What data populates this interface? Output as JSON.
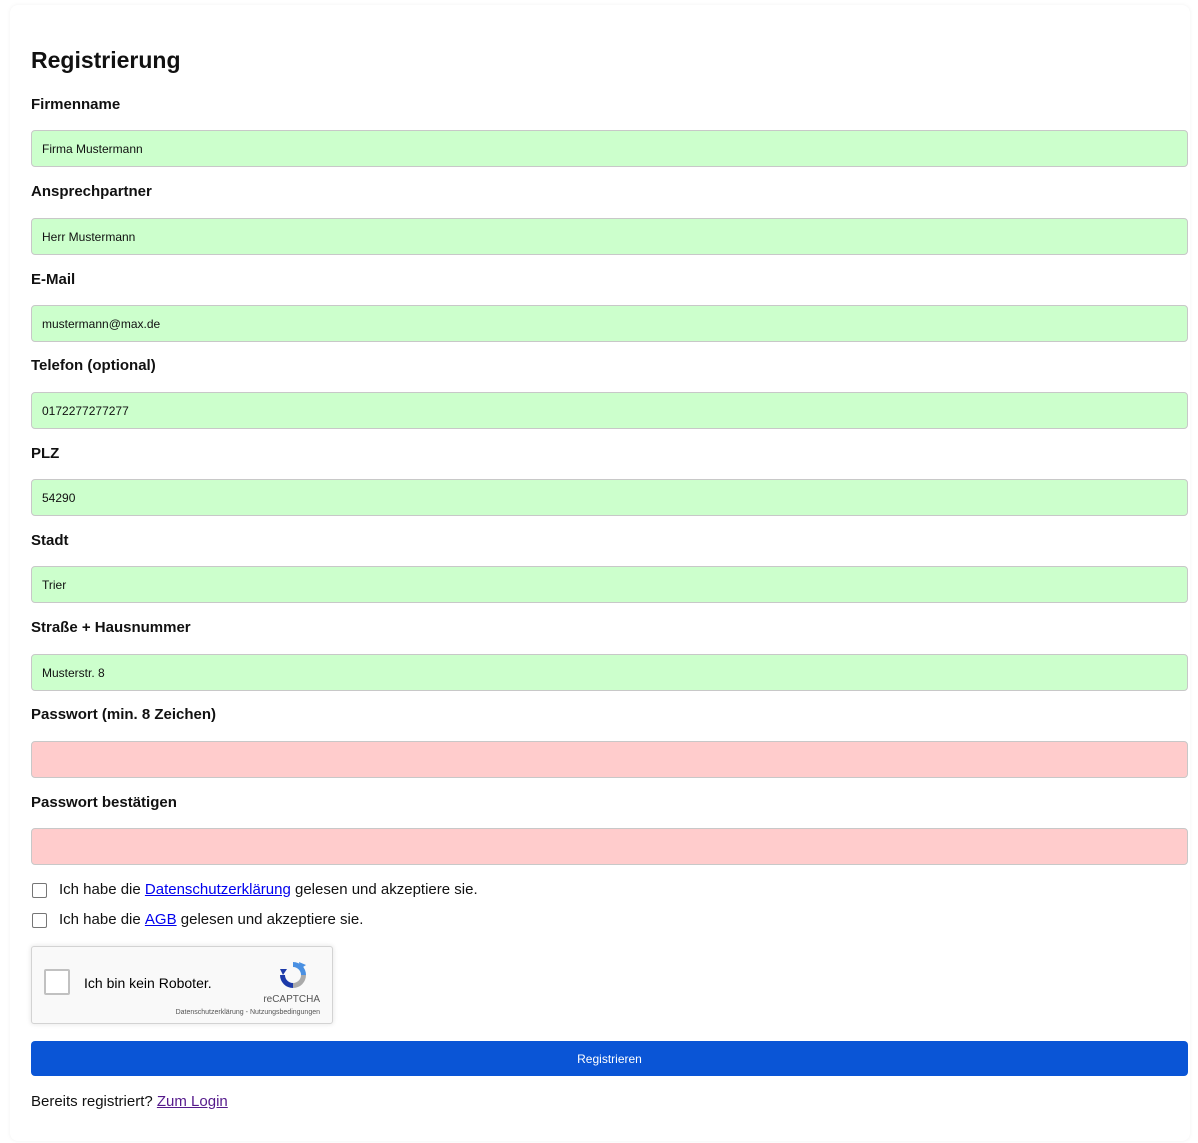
{
  "form": {
    "title": "Registrierung",
    "fields": [
      {
        "label": "Firmenname",
        "value": "Firma Mustermann",
        "state": "valid"
      },
      {
        "label": "Ansprechpartner",
        "value": "Herr Mustermann",
        "state": "valid"
      },
      {
        "label": "E-Mail",
        "value": "mustermann@max.de",
        "state": "valid"
      },
      {
        "label": "Telefon (optional)",
        "value": "0172277277277",
        "state": "valid"
      },
      {
        "label": "PLZ",
        "value": "54290",
        "state": "valid"
      },
      {
        "label": "Stadt",
        "value": "Trier",
        "state": "valid"
      },
      {
        "label": "Straße + Hausnummer",
        "value": "Musterstr. 8",
        "state": "valid"
      },
      {
        "label": "Passwort (min. 8 Zeichen)",
        "value": "",
        "state": "invalid"
      },
      {
        "label": "Passwort bestätigen",
        "value": "",
        "state": "invalid"
      }
    ],
    "privacy_consent": {
      "prefix": "Ich habe die",
      "link": "Datenschutzerklärung",
      "suffix": "gelesen und akzeptiere sie.",
      "checked": false
    },
    "terms_consent": {
      "prefix": "Ich habe die",
      "link": "AGB",
      "suffix": "gelesen und akzeptiere sie.",
      "checked": false
    },
    "recaptcha": {
      "label": "Ich bin kein Roboter.",
      "brand": "reCAPTCHA",
      "privacy_link": "Datenschutzerklärung",
      "separator": "-",
      "terms_link": "Nutzungsbedingungen"
    },
    "submit_label": "Registrieren",
    "login_prompt": "Bereits registriert?",
    "login_link": "Zum Login"
  },
  "colors": {
    "valid_bg": "#ccffcc",
    "invalid_bg": "#ffcccc",
    "button_bg": "#0a55d6",
    "link": "#0000ee",
    "visited_link": "#551a8b"
  }
}
